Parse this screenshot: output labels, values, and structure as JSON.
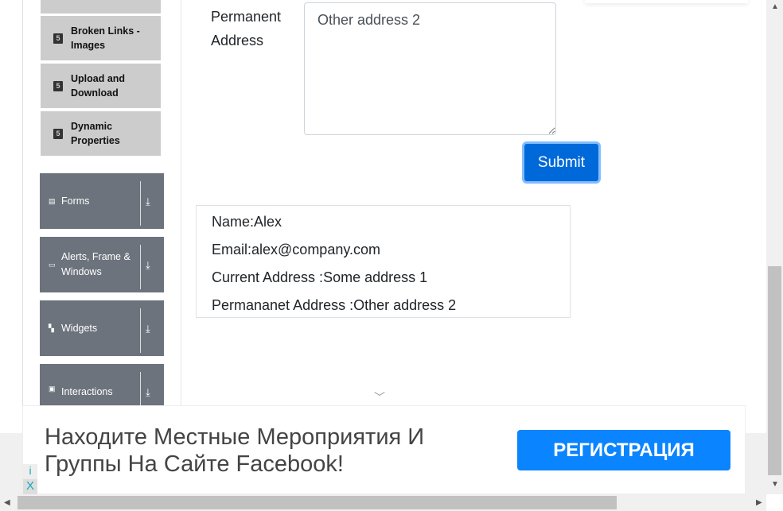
{
  "sidebar": {
    "subitems": [
      {
        "label": "Broken Links - Images",
        "icon": "html5-icon"
      },
      {
        "label": "Upload and Download",
        "icon": "html5-icon"
      },
      {
        "label": "Dynamic Properties",
        "icon": "html5-icon"
      }
    ],
    "groups": [
      {
        "label": "Forms"
      },
      {
        "label": "Alerts, Frame & Windows"
      },
      {
        "label": "Widgets"
      },
      {
        "label": "Interactions"
      }
    ]
  },
  "form": {
    "permanent_address_label": "Permanent Address",
    "permanent_address_value": "Other address 2",
    "submit_label": "Submit"
  },
  "output": {
    "name": "Name:Alex",
    "email": "Email:alex@company.com",
    "current": "Current Address :Some address 1",
    "permanent": "Permananet Address :Other address 2"
  },
  "ad": {
    "text": "Находите Местные Мероприятия И Группы На Сайте Facebook!",
    "button": "РЕГИСТРАЦИЯ",
    "info": "i",
    "close": "X"
  }
}
